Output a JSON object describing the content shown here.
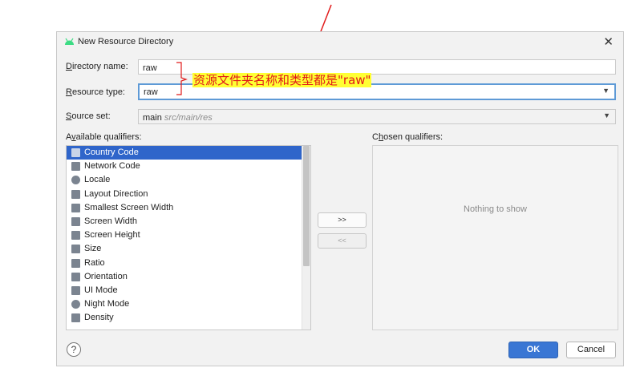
{
  "dialog": {
    "title": "New Resource Directory",
    "close_glyph": "✕",
    "directory_name": {
      "label_underlined": "D",
      "label_rest": "irectory name:",
      "value": "raw"
    },
    "resource_type": {
      "label_underlined": "R",
      "label_rest": "esource type:",
      "value": "raw"
    },
    "source_set": {
      "label_underlined": "S",
      "label_rest": "ource set:",
      "value_main": "main",
      "value_path": "src/main/res"
    },
    "available": {
      "label_pre": "A",
      "label_underlined": "v",
      "label_rest": "ailable qualifiers:",
      "items": [
        {
          "label": "Country Code",
          "icon": "country-code-icon",
          "selected": true
        },
        {
          "label": "Network Code",
          "icon": "network-code-icon",
          "selected": false
        },
        {
          "label": "Locale",
          "icon": "globe-icon",
          "selected": false
        },
        {
          "label": "Layout Direction",
          "icon": "layout-direction-icon",
          "selected": false
        },
        {
          "label": "Smallest Screen Width",
          "icon": "smallest-width-icon",
          "selected": false
        },
        {
          "label": "Screen Width",
          "icon": "screen-width-icon",
          "selected": false
        },
        {
          "label": "Screen Height",
          "icon": "screen-height-icon",
          "selected": false
        },
        {
          "label": "Size",
          "icon": "size-icon",
          "selected": false
        },
        {
          "label": "Ratio",
          "icon": "ratio-icon",
          "selected": false
        },
        {
          "label": "Orientation",
          "icon": "orientation-icon",
          "selected": false
        },
        {
          "label": "UI Mode",
          "icon": "ui-mode-icon",
          "selected": false
        },
        {
          "label": "Night Mode",
          "icon": "night-mode-icon",
          "selected": false
        },
        {
          "label": "Density",
          "icon": "density-icon",
          "selected": false
        }
      ]
    },
    "chosen": {
      "label_pre": "C",
      "label_underlined": "h",
      "label_rest": "osen qualifiers:",
      "empty_text": "Nothing to show"
    },
    "add_button": ">>",
    "remove_button": "<<",
    "help": "?",
    "ok": "OK",
    "cancel": "Cancel"
  },
  "annotation": {
    "text": "资源文件夹名称和类型都是\"raw\"",
    "color": "#e11a1a",
    "highlight": "#ffff33"
  },
  "colors": {
    "selection": "#2f65ca",
    "primary_button": "#3976d4",
    "focus_border": "#5e9ad6"
  }
}
